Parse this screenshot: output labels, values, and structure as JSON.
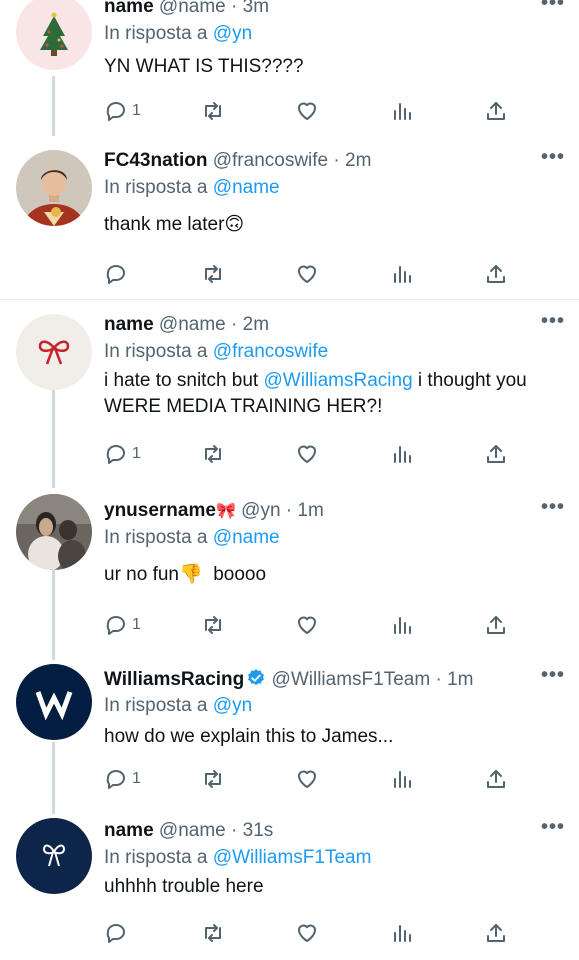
{
  "reply_prefix": "In risposta a",
  "more_label": "•••",
  "colors": {
    "accent": "#1d9bf0",
    "muted": "#536471",
    "verified": "#1d9bf0"
  },
  "tweets": [
    {
      "username": "name",
      "emoji": "",
      "handle": "@name",
      "time": "3m",
      "reply_to": "@yn",
      "text": "YN WHAT IS THIS????",
      "reply_count": "1",
      "avatar": "christmas-tree-avatar"
    },
    {
      "username": "FC43nation",
      "emoji": "",
      "handle": "@francoswife",
      "time": "2m",
      "reply_to": "@name",
      "text": "thank me later🙃",
      "reply_count": "",
      "avatar": "portrait-avatar"
    },
    {
      "username": "name",
      "emoji": "",
      "handle": "@name",
      "time": "2m",
      "reply_to": "@francoswife",
      "text_before": "i hate to snitch but ",
      "text_mention": "@WilliamsRacing",
      "text_after": " i thought you WERE MEDIA TRAINING HER?!",
      "reply_count": "1",
      "avatar": "red-bow-avatar"
    },
    {
      "username": "ynusername",
      "emoji": "🎀",
      "handle": "@yn",
      "time": "1m",
      "reply_to": "@name",
      "text": "ur no fun👎  boooo",
      "reply_count": "1",
      "avatar": "photo-avatar"
    },
    {
      "username": "WilliamsRacing",
      "emoji": "",
      "handle": "@WilliamsF1Team",
      "time": "1m",
      "reply_to": "@yn",
      "text": "how do we explain this to James...",
      "reply_count": "1",
      "avatar": "williams-logo-avatar",
      "verified": true
    },
    {
      "username": "name",
      "emoji": "",
      "handle": "@name",
      "time": "31s",
      "reply_to": "@WilliamsF1Team",
      "text": "uhhhh trouble here",
      "reply_count": "",
      "avatar": "white-bow-avatar"
    }
  ]
}
